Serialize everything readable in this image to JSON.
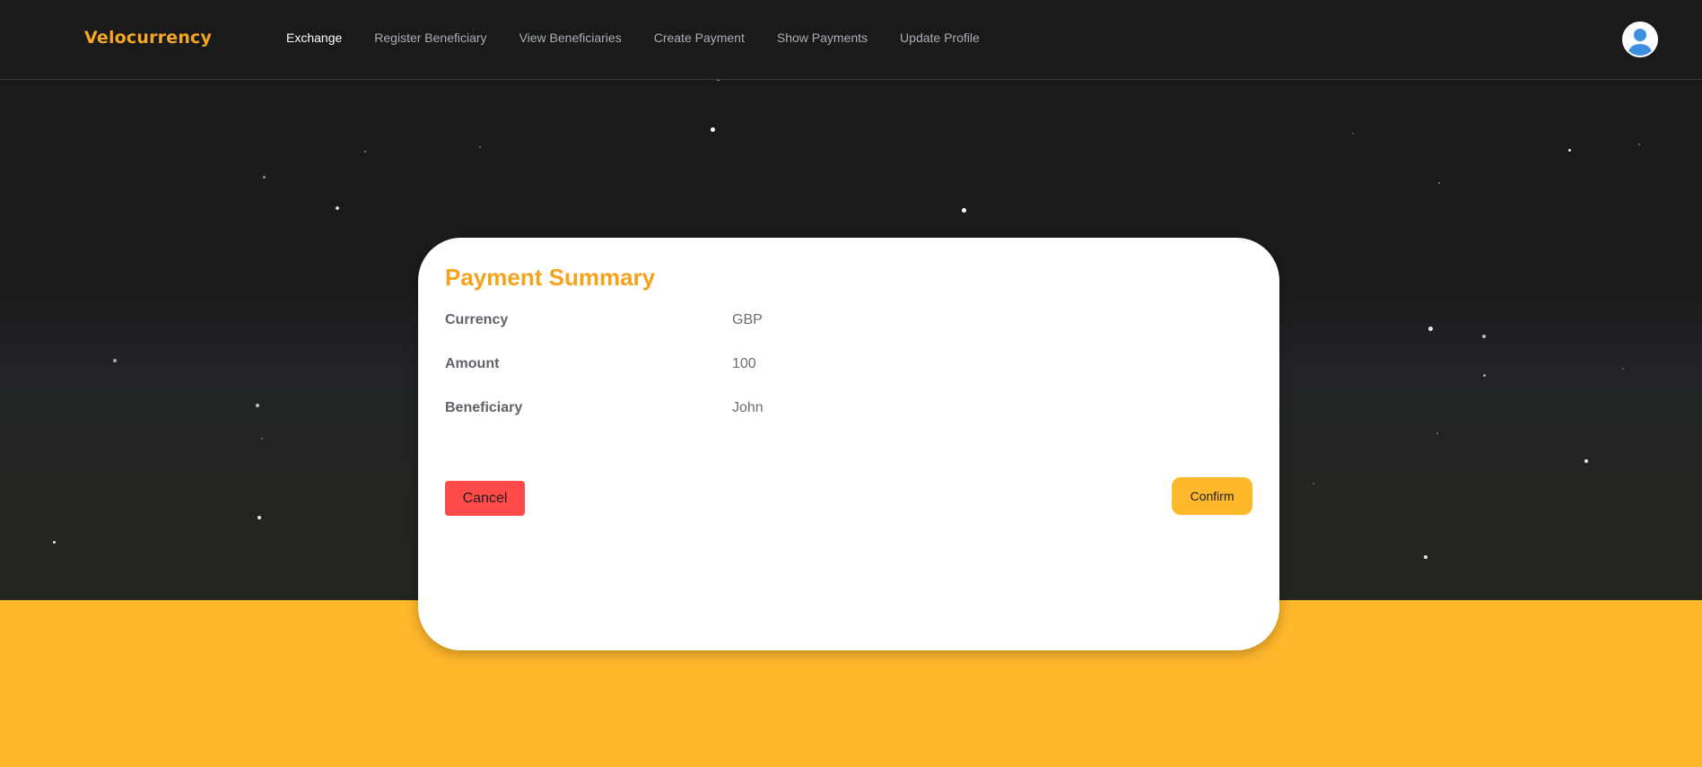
{
  "navbar": {
    "brand": "Velocurrency",
    "links": [
      {
        "label": "Exchange",
        "active": true
      },
      {
        "label": "Register Beneficiary",
        "active": false
      },
      {
        "label": "View Beneficiaries",
        "active": false
      },
      {
        "label": "Create Payment",
        "active": false
      },
      {
        "label": "Show Payments",
        "active": false
      },
      {
        "label": "Update Profile",
        "active": false
      }
    ],
    "avatar_icon": "user-avatar-icon"
  },
  "summary": {
    "title": "Payment Summary",
    "rows": [
      {
        "label": "Currency",
        "value": "GBP"
      },
      {
        "label": "Amount",
        "value": "100"
      },
      {
        "label": "Beneficiary",
        "value": "John"
      }
    ],
    "cancel_label": "Cancel",
    "confirm_label": "Confirm"
  },
  "colors": {
    "brand": "#f5a623",
    "accent": "#ffb72c",
    "cancel": "#ff4a4a",
    "background": "#1a1a1a"
  }
}
